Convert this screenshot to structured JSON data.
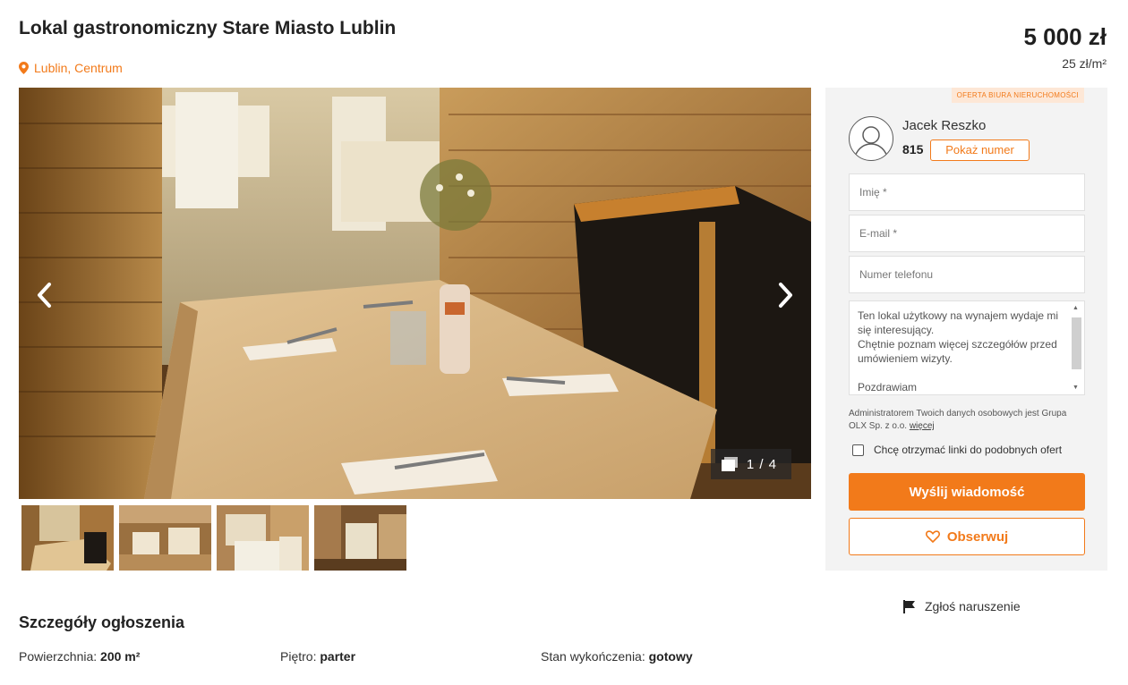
{
  "listing": {
    "title": "Lokal gastronomiczny Stare Miasto Lublin",
    "location": "Lublin, Centrum",
    "price": "5 000 zł",
    "price_per_m2": "25 zł/m²"
  },
  "gallery": {
    "counter": "1 / 4",
    "thumbnails": [
      "thumbnail-1",
      "thumbnail-2",
      "thumbnail-3",
      "thumbnail-4"
    ],
    "icons": {
      "prev": "chevron-left-icon",
      "next": "chevron-right-icon",
      "counter": "photos-icon"
    }
  },
  "contact": {
    "badge": "OFERTA BIURA NIERUCHOMOŚCI",
    "agent_name": "Jacek Reszko",
    "agent_id": "815",
    "show_number": "Pokaż numer",
    "name_placeholder": "Imię *",
    "email_placeholder": "E-mail *",
    "phone_placeholder": "Numer telefonu",
    "message": "Ten lokal użytkowy na wynajem wydaje mi się interesujący.\nChętnie poznam więcej szczegółów przed umówieniem wizyty.\n\nPozdrawiam",
    "privacy_text": "Administratorem Twoich danych osobowych jest Grupa OLX Sp. z o.o.",
    "privacy_link": "więcej",
    "checkbox_label": "Chcę otrzymać linki do podobnych ofert",
    "send_button": "Wyślij wiadomość",
    "follow_button": "Obserwuj"
  },
  "report": {
    "label": "Zgłoś naruszenie"
  },
  "details": {
    "heading": "Szczegóły ogłoszenia",
    "area_label": "Powierzchnia:",
    "area_value": "200 m²",
    "floor_label": "Piętro:",
    "floor_value": "parter",
    "finish_label": "Stan wykończenia:",
    "finish_value": "gotowy"
  },
  "colors": {
    "accent": "#f27a1a",
    "panel_bg": "#f3f3f3",
    "badge_bg": "#fde7d6"
  }
}
